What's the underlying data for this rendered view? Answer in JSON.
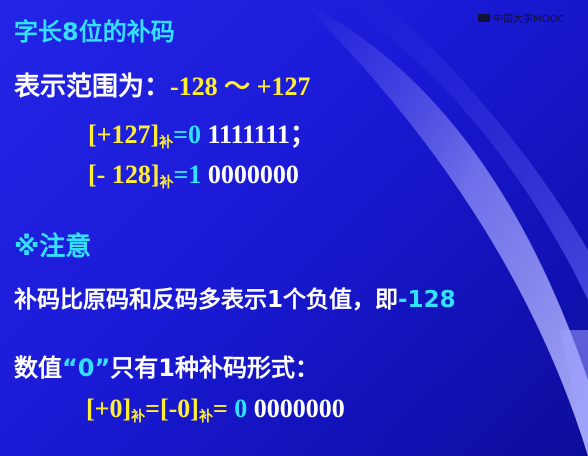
{
  "watermark": "中国大学MOOC",
  "lines": {
    "title": "字长8位的补码",
    "range": {
      "label": "表示范围为：",
      "value": "-128 ～ +127"
    },
    "pos127": {
      "bracket": "[+127]",
      "sub": "补",
      "eq": "=",
      "sign": "0",
      "rest": " 1111111；"
    },
    "neg128": {
      "bracket": "[- 128]",
      "sub": "补",
      "eq": "=",
      "sign": "1",
      "rest": " 0000000"
    },
    "note": "※注意",
    "note_text": {
      "text": "补码比原码和反码多表示1个负值，即",
      "value": "-128"
    },
    "zero_text": {
      "a": "数值",
      "b": "“0”",
      "c": "只有1种补码形式："
    },
    "zero_eq": {
      "p1": "[+0]",
      "sub1": "补",
      "eq1": "=",
      "p2": "[-0]",
      "sub2": "补",
      "eq2": "=",
      "sign": " 0",
      "rest": " 0000000"
    }
  },
  "colors": {
    "background": "#1a1ad0",
    "cyan": "#33e0ff",
    "yellow": "#ffee33",
    "white": "#ffffff"
  }
}
